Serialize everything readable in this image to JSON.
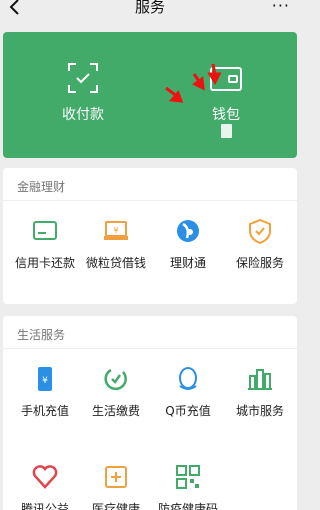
{
  "header": {
    "title": "服务",
    "back_glyph": "<",
    "more_glyph": "···"
  },
  "wallet_card": {
    "pay_label": "收付款",
    "wallet_label": "钱包",
    "accent": "#43ab6a"
  },
  "finance": {
    "title": "金融理财",
    "items": [
      {
        "label": "信用卡还款",
        "icon": "credit-card-icon"
      },
      {
        "label": "微粒贷借钱",
        "icon": "loan-icon"
      },
      {
        "label": "理财通",
        "icon": "wealth-icon"
      },
      {
        "label": "保险服务",
        "icon": "insurance-icon"
      }
    ]
  },
  "life": {
    "title": "生活服务",
    "items": [
      {
        "label": "手机充值",
        "icon": "phone-topup-icon"
      },
      {
        "label": "生活缴费",
        "icon": "utility-payment-icon"
      },
      {
        "label": "Q币充值",
        "icon": "qq-coin-icon"
      },
      {
        "label": "城市服务",
        "icon": "city-service-icon"
      },
      {
        "label": "腾讯公益",
        "icon": "charity-heart-icon"
      },
      {
        "label": "医疗健康",
        "icon": "medical-icon"
      },
      {
        "label": "防疫健康码",
        "icon": "health-code-icon"
      }
    ]
  },
  "colors": {
    "green": "#43ab6a",
    "blue": "#2c8fe6",
    "orange": "#f0a03c",
    "red": "#e0464d",
    "annotation_arrow": "#e11"
  }
}
